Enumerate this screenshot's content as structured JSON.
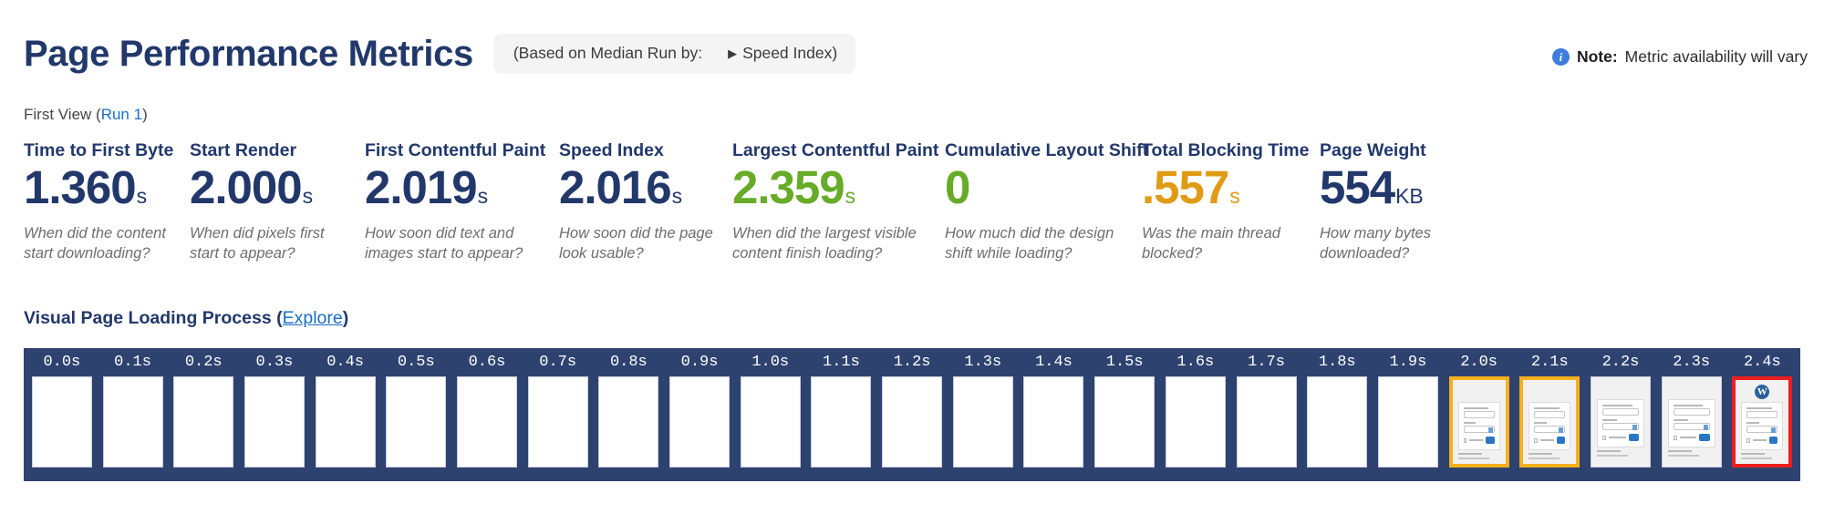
{
  "header": {
    "title": "Page Performance Metrics",
    "median_pill": {
      "label": "(Based on Median Run by:",
      "caret_icon": "triangle-right-icon",
      "value": "Speed Index)"
    },
    "note": {
      "icon": "info-circle-icon",
      "strong": "Note:",
      "text": "Metric availability will vary"
    }
  },
  "first_view": {
    "prefix": "First View (",
    "run_link": "Run 1",
    "suffix": ")"
  },
  "metrics": [
    {
      "label": "Time to First Byte",
      "value": "1.360",
      "unit": "s",
      "color": "#22386b",
      "description": "When did the content\nstart downloading?"
    },
    {
      "label": "Start Render",
      "value": "2.000",
      "unit": "s",
      "color": "#22386b",
      "description": "When did pixels first\nstart to appear?"
    },
    {
      "label": "First Contentful Paint",
      "value": "2.019",
      "unit": "s",
      "color": "#22386b",
      "description": "How soon did text and\nimages start to appear?"
    },
    {
      "label": "Speed Index",
      "value": "2.016",
      "unit": "s",
      "color": "#22386b",
      "description": "How soon did the page\nlook usable?"
    },
    {
      "label": "Largest Contentful Paint",
      "value": "2.359",
      "unit": "s",
      "color": "#67ab28",
      "description": "When did the largest visible\ncontent finish loading?"
    },
    {
      "label": "Cumulative Layout Shift",
      "value": "0",
      "unit": "",
      "color": "#67ab28",
      "description": "How much did the design\nshift while loading?"
    },
    {
      "label": "Total Blocking Time",
      "value": ".557",
      "unit": "s",
      "color": "#e09b16",
      "description": "Was the main thread\nblocked?"
    },
    {
      "label": "Page Weight",
      "value": "554",
      "unit": "KB",
      "color": "#22386b",
      "description": "How many bytes\ndownloaded?"
    }
  ],
  "visual_loading": {
    "title": "Visual Page Loading Process",
    "open_paren": " (",
    "explore_link": "Explore",
    "close_paren": ")"
  },
  "filmstrip": {
    "background_color": "#2e4270",
    "highlight_orange": "#f5b01c",
    "highlight_red": "#ef1d1d",
    "frames": [
      {
        "time": "0.0s",
        "content": "blank",
        "highlight": "none"
      },
      {
        "time": "0.1s",
        "content": "blank",
        "highlight": "none"
      },
      {
        "time": "0.2s",
        "content": "blank",
        "highlight": "none"
      },
      {
        "time": "0.3s",
        "content": "blank",
        "highlight": "none"
      },
      {
        "time": "0.4s",
        "content": "blank",
        "highlight": "none"
      },
      {
        "time": "0.5s",
        "content": "blank",
        "highlight": "none"
      },
      {
        "time": "0.6s",
        "content": "blank",
        "highlight": "none"
      },
      {
        "time": "0.7s",
        "content": "blank",
        "highlight": "none"
      },
      {
        "time": "0.8s",
        "content": "blank",
        "highlight": "none"
      },
      {
        "time": "0.9s",
        "content": "blank",
        "highlight": "none"
      },
      {
        "time": "1.0s",
        "content": "blank",
        "highlight": "none"
      },
      {
        "time": "1.1s",
        "content": "blank",
        "highlight": "none"
      },
      {
        "time": "1.2s",
        "content": "blank",
        "highlight": "none"
      },
      {
        "time": "1.3s",
        "content": "blank",
        "highlight": "none"
      },
      {
        "time": "1.4s",
        "content": "blank",
        "highlight": "none"
      },
      {
        "time": "1.5s",
        "content": "blank",
        "highlight": "none"
      },
      {
        "time": "1.6s",
        "content": "blank",
        "highlight": "none"
      },
      {
        "time": "1.7s",
        "content": "blank",
        "highlight": "none"
      },
      {
        "time": "1.8s",
        "content": "blank",
        "highlight": "none"
      },
      {
        "time": "1.9s",
        "content": "blank",
        "highlight": "none"
      },
      {
        "time": "2.0s",
        "content": "login-form",
        "highlight": "orange"
      },
      {
        "time": "2.1s",
        "content": "login-form",
        "highlight": "orange"
      },
      {
        "time": "2.2s",
        "content": "login-form",
        "highlight": "none"
      },
      {
        "time": "2.3s",
        "content": "login-form",
        "highlight": "none"
      },
      {
        "time": "2.4s",
        "content": "login-form-logo",
        "highlight": "red"
      }
    ]
  }
}
